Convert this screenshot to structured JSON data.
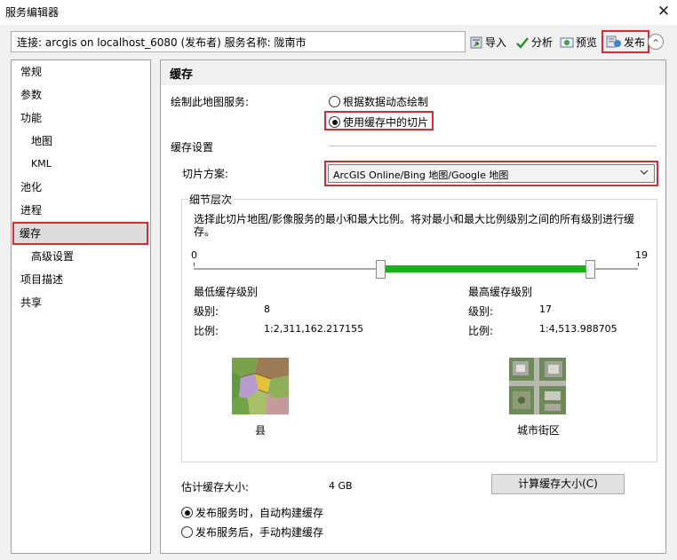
{
  "window": {
    "title": "服务编辑器",
    "close_symbol": "✕"
  },
  "connection": {
    "text": "连接: arcgis on localhost_6080 (发布者)    服务名称: 陇南市"
  },
  "toolbar": {
    "import_label": "导入",
    "analyze_label": "分析",
    "preview_label": "预览",
    "publish_label": "发布",
    "collapse_symbol": "⌃"
  },
  "nav": {
    "items": [
      {
        "label": "常规"
      },
      {
        "label": "参数"
      },
      {
        "label": "功能"
      },
      {
        "label": "地图"
      },
      {
        "label": "KML"
      },
      {
        "label": "池化"
      },
      {
        "label": "进程"
      },
      {
        "label": "缓存"
      },
      {
        "label": "高级设置"
      },
      {
        "label": "项目描述"
      },
      {
        "label": "共享"
      }
    ],
    "selected": "缓存"
  },
  "cache": {
    "title": "缓存",
    "draw_label": "绘制此地图服务:",
    "option_dynamic": "根据数据动态绘制",
    "option_cached": "使用缓存中的切片",
    "selected_option": "使用缓存中的切片",
    "settings_label": "缓存设置",
    "tiling_label": "切片方案:",
    "tiling_value": "ArcGIS Online/Bing 地图/Google 地图",
    "detail_title": "细节层次",
    "detail_desc": "选择此切片地图/影像服务的最小和最大比例。将对最小和最大比例级别之间的所有级别进行缓存。",
    "slider": {
      "min": 0,
      "max": 19,
      "low": 8,
      "high": 17,
      "accent": "#16b316"
    },
    "min_title": "最低缓存级别",
    "max_title": "最高缓存级别",
    "level_label": "级别:",
    "scale_label": "比例:",
    "min_level": "8",
    "min_scale": "1:2,311,162.217155",
    "max_level": "17",
    "max_scale": "1:4,513.988705",
    "min_caption": "县",
    "max_caption": "城市街区",
    "est_label": "估计缓存大小:",
    "est_value": "4 GB",
    "calc_button": "计算缓存大小(C)",
    "build_auto": "发布服务时，自动构建缓存",
    "build_manual": "发布服务后，手动构建缓存",
    "build_selected": "发布服务时，自动构建缓存"
  },
  "colors": {
    "highlight": "#e0262e",
    "slider_fill": "#16b316"
  }
}
